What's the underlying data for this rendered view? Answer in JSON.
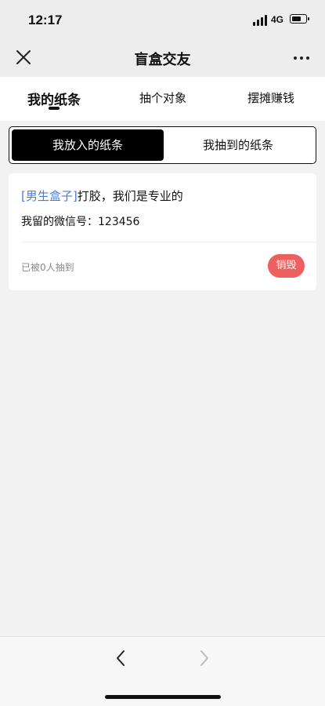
{
  "status_bar": {
    "time": "12:17",
    "network": "4G",
    "battery_level": 0.7,
    "icons": [
      "signal-bars-icon",
      "battery-icon"
    ]
  },
  "title_bar": {
    "title": "盲盒交友",
    "left_icon": "close-icon",
    "right_icon": "more-dots-icon"
  },
  "tabs": [
    {
      "label": "我的纸条",
      "active": true
    },
    {
      "label": "抽个对象",
      "active": false
    },
    {
      "label": "摆摊赚钱",
      "active": false
    }
  ],
  "segment": {
    "options": [
      {
        "label": "我放入的纸条",
        "active": true
      },
      {
        "label": "我抽到的纸条",
        "active": false
      }
    ]
  },
  "note_card": {
    "tag": "[男生盒子]",
    "message": "打胶，我们是专业的",
    "wechat": "我留的微信号：123456",
    "draw_count": "已被0人抽到",
    "destroy_label": "销毁",
    "destroy_color": "#ee5f5f",
    "tag_color": "#4a7cd6"
  },
  "bottom_nav": {
    "back_icon": "chevron-left-icon",
    "forward_icon": "chevron-right-icon",
    "forward_disabled": true
  }
}
